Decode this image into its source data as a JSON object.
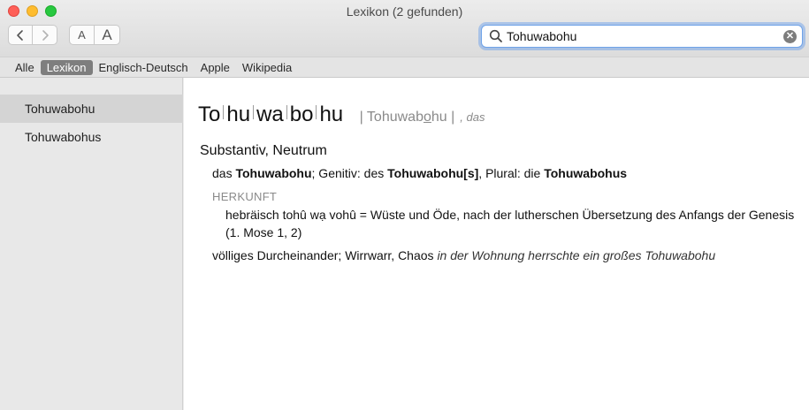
{
  "window": {
    "title": "Lexikon (2 gefunden)"
  },
  "toolbar": {
    "back_icon": "chevron-left-icon",
    "forward_icon": "chevron-right-icon",
    "font_smaller_label": "A",
    "font_larger_label": "A"
  },
  "search": {
    "value": "Tohuwabohu",
    "placeholder": ""
  },
  "tabs": [
    {
      "label": "Alle"
    },
    {
      "label": "Lexikon"
    },
    {
      "label": "Englisch-Deutsch"
    },
    {
      "label": "Apple"
    },
    {
      "label": "Wikipedia"
    }
  ],
  "active_tab": "Lexikon",
  "results": [
    {
      "label": "Tohuwabohu"
    },
    {
      "label": "Tohuwabohus"
    }
  ],
  "entry": {
    "syllables": [
      "To",
      "hu",
      "wa",
      "bo",
      "hu"
    ],
    "pron_before": "| Tohuwab",
    "pron_mark": "o",
    "pron_after": "hu |",
    "gender": ", das",
    "part_of_speech": "Substantiv, Neutrum",
    "forms": {
      "t1": "das ",
      "b1": "Tohuwabohu",
      "t2": "; Genitiv: des ",
      "b2": "Tohuwabohu[s]",
      "t3": ", Plural: die ",
      "b3": "Tohuwabohus"
    },
    "etymology_label": "HERKUNFT",
    "etymology_text": "hebräisch tohû wạ vohû = Wüste und Öde, nach der lutherschen Übersetzung des Anfangs der Genesis (1. Mose 1, 2)",
    "sense_text": "völliges Durcheinander; Wirrwarr, Chaos ",
    "sense_example": "in der Wohnung herrschte ein großes Tohuwabohu"
  },
  "colors": {
    "active_tab_bg": "#7e7e7e",
    "search_focus": "#6fa3e8",
    "selected_row": "#d4d4d4"
  }
}
